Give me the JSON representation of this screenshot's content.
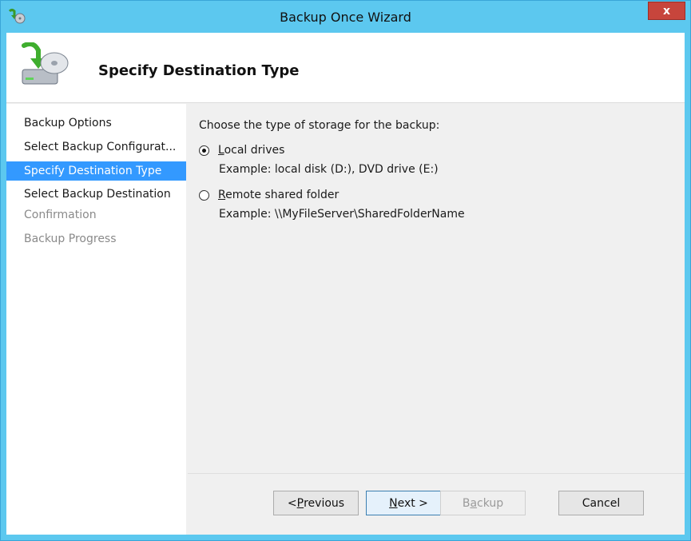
{
  "window": {
    "title": "Backup Once Wizard",
    "close_label": "x"
  },
  "header": {
    "title": "Specify Destination Type"
  },
  "nav": {
    "items": [
      {
        "label": "Backup Options",
        "state": "normal"
      },
      {
        "label": "Select Backup Configurat...",
        "state": "normal"
      },
      {
        "label": "Specify Destination Type",
        "state": "selected"
      },
      {
        "label": "Select Backup Destination",
        "state": "normal"
      },
      {
        "label": "Confirmation",
        "state": "disabled"
      },
      {
        "label": "Backup Progress",
        "state": "disabled"
      }
    ]
  },
  "content": {
    "prompt": "Choose the type of storage for the backup:",
    "options": [
      {
        "accel": "L",
        "rest": "ocal drives",
        "checked": true,
        "example": "Example: local disk (D:), DVD drive (E:)"
      },
      {
        "accel": "R",
        "rest": "emote shared folder",
        "checked": false,
        "example": "Example: \\\\MyFileServer\\SharedFolderName"
      }
    ]
  },
  "buttons": {
    "previous": {
      "pre": "< ",
      "accel": "P",
      "rest": "revious"
    },
    "next": {
      "accel": "N",
      "rest": "ext >"
    },
    "backup": {
      "pre": "B",
      "accel": "a",
      "rest": "ckup"
    },
    "cancel": {
      "label": "Cancel"
    }
  },
  "colors": {
    "titlebar": "#5cc8ef",
    "selected_nav": "#3399ff",
    "close_button": "#c7453c"
  }
}
